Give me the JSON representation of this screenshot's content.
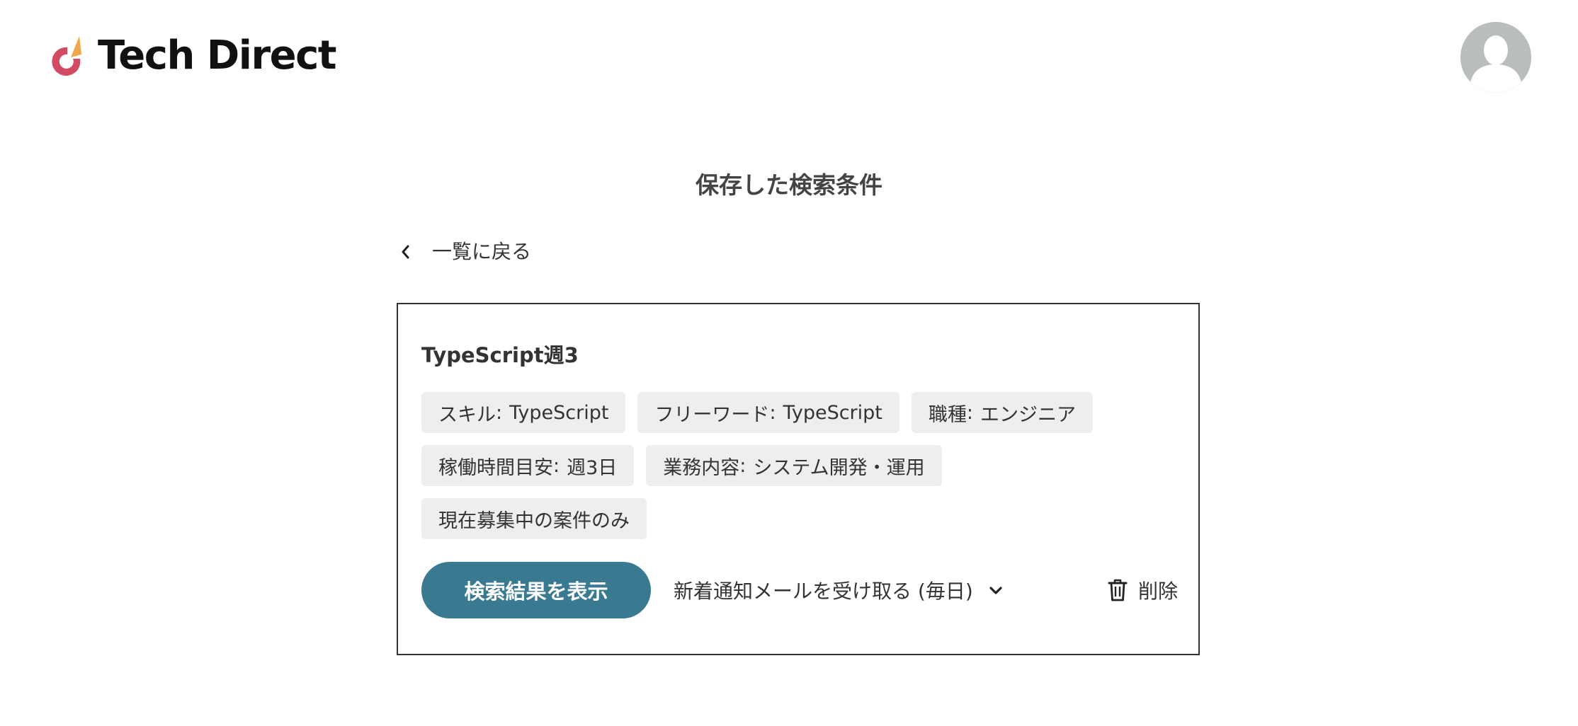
{
  "header": {
    "brand": "Tech Direct",
    "logo_icon": "tech-direct-logo-icon",
    "avatar_icon": "user-avatar-icon",
    "colors": {
      "logo_red": "#d24a63",
      "logo_orange": "#f0a64a",
      "avatar_bg": "#b9bdbe"
    }
  },
  "page": {
    "title": "保存した検索条件",
    "back_label": "一覧に戻る",
    "back_icon": "chevron-left-icon"
  },
  "saved_search": {
    "name": "TypeScript週3",
    "conditions": [
      [
        {
          "key": "スキル",
          "sep": ":",
          "value": "TypeScript"
        },
        {
          "key": "フリーワード",
          "sep": ":",
          "value": "TypeScript"
        },
        {
          "key": "職種",
          "sep": ":",
          "value": "エンジニア"
        }
      ],
      [
        {
          "key": "稼働時間目安",
          "sep": ":",
          "value": "週3日"
        },
        {
          "key": "業務内容",
          "sep": ":",
          "value": "システム開発・運用"
        }
      ],
      [
        {
          "key": "現在募集中の案件のみ",
          "sep": "",
          "value": ""
        }
      ]
    ],
    "show_results_label": "検索結果を表示",
    "notify_label": "新着通知メールを受け取る (毎日)",
    "notify_icon": "chevron-down-icon",
    "delete_label": "削除",
    "delete_icon": "trash-icon",
    "colors": {
      "primary": "#3a7a90",
      "chip_bg": "#eeeeee",
      "border": "#333333"
    }
  }
}
